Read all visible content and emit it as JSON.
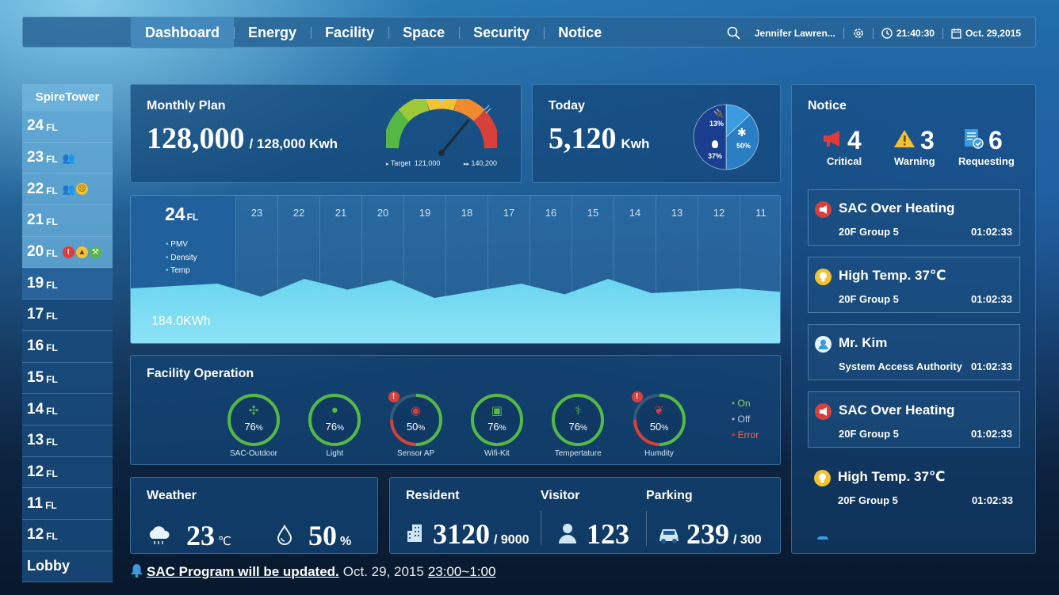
{
  "nav": {
    "tabs": [
      "Dashboard",
      "Energy",
      "Facility",
      "Space",
      "Security",
      "Notice"
    ],
    "user": "Jennifer Lawren...",
    "time": "21:40:30",
    "date": "Oct. 29,2015"
  },
  "sidebar": {
    "building": "SpireTower",
    "floors": [
      {
        "num": "24",
        "unit": "FL"
      },
      {
        "num": "23",
        "unit": "FL"
      },
      {
        "num": "22",
        "unit": "FL"
      },
      {
        "num": "21",
        "unit": "FL"
      },
      {
        "num": "20",
        "unit": "FL"
      },
      {
        "num": "19",
        "unit": "FL"
      },
      {
        "num": "17",
        "unit": "FL"
      },
      {
        "num": "16",
        "unit": "FL"
      },
      {
        "num": "15",
        "unit": "FL"
      },
      {
        "num": "14",
        "unit": "FL"
      },
      {
        "num": "13",
        "unit": "FL"
      },
      {
        "num": "12",
        "unit": "FL"
      },
      {
        "num": "11",
        "unit": "FL"
      },
      {
        "num": "12",
        "unit": "FL"
      }
    ],
    "lobby": "Lobby"
  },
  "monthly": {
    "title": "Monthly Plan",
    "value": "128,000",
    "target": "/ 128,000 Kwh",
    "gauge_target_label": "Target",
    "gauge_target_value": "121,000",
    "gauge_current": "140,200",
    "gauge_level": 0.72
  },
  "today": {
    "title": "Today",
    "value": "5,120",
    "unit": "Kwh",
    "pie": [
      {
        "label": "13%",
        "value": 13,
        "color": "#3a9be0"
      },
      {
        "label": "37%",
        "value": 37,
        "color": "#2a7ec4"
      },
      {
        "label": "50%",
        "value": 50,
        "color": "#1a3f8f"
      }
    ]
  },
  "floorchart": {
    "floor": "24",
    "unit": "FL",
    "legend": [
      "PMV",
      "Density",
      "Temp"
    ],
    "columns": [
      "23",
      "22",
      "21",
      "20",
      "19",
      "18",
      "17",
      "16",
      "15",
      "14",
      "13",
      "12",
      "11"
    ],
    "value_label": "184.0KWh",
    "area": [
      12,
      14,
      16,
      5,
      20,
      11,
      19,
      4,
      10,
      16,
      7,
      20,
      8,
      10,
      12,
      9
    ]
  },
  "facility": {
    "title": "Facility Operation",
    "items": [
      {
        "label": "SAC-Outdoor",
        "value": "76",
        "pct": "%",
        "level": 0.76,
        "status": "on",
        "icon": "fan-icon"
      },
      {
        "label": "Light",
        "value": "76",
        "pct": "%",
        "level": 0.76,
        "status": "on",
        "icon": "bulb-icon"
      },
      {
        "label": "Sensor AP",
        "value": "50",
        "pct": "%",
        "level": 0.5,
        "status": "error",
        "icon": "sensor-icon"
      },
      {
        "label": "Wifi-Kit",
        "value": "76",
        "pct": "%",
        "level": 0.76,
        "status": "on",
        "icon": "chip-icon"
      },
      {
        "label": "Tempertature",
        "value": "76",
        "pct": "%",
        "level": 0.76,
        "status": "on",
        "icon": "thermometer-icon"
      },
      {
        "label": "Humdity",
        "value": "50",
        "pct": "%",
        "level": 0.5,
        "status": "error",
        "icon": "droplet-icon"
      }
    ],
    "legend": [
      "On",
      "Off",
      "Error"
    ]
  },
  "weather": {
    "title": "Weather",
    "temp": "23",
    "temp_unit": "℃",
    "humidity": "50",
    "humidity_unit": "%"
  },
  "people": {
    "resident_title": "Resident",
    "resident": "3120",
    "resident_total": "/ 9000",
    "visitor_title": "Visitor",
    "visitor": "123",
    "parking_title": "Parking",
    "parking": "239",
    "parking_total": "/ 300"
  },
  "notice": {
    "title": "Notice",
    "summary": [
      {
        "count": "4",
        "label": "Critical"
      },
      {
        "count": "3",
        "label": "Warning"
      },
      {
        "count": "6",
        "label": "Requesting"
      }
    ],
    "items": [
      {
        "title": "SAC Over Heating",
        "sub": "20F Group 5",
        "time": "01:02:33",
        "kind": "critical"
      },
      {
        "title": "High Temp. 37℃",
        "sub": "20F Group 5",
        "time": "01:02:33",
        "kind": "warning"
      },
      {
        "title": "Mr. Kim",
        "sub": "System Access Authority",
        "time": "01:02:33",
        "kind": "user"
      },
      {
        "title": "SAC Over Heating",
        "sub": "20F Group 5",
        "time": "01:02:33",
        "kind": "critical"
      },
      {
        "title": "High Temp. 37℃",
        "sub": "20F Group 5",
        "time": "01:02:33",
        "kind": "warning"
      }
    ]
  },
  "announcement": {
    "text": "SAC Program will be updated.",
    "date": "Oct. 29, 2015",
    "time": "23:00~1:00"
  }
}
